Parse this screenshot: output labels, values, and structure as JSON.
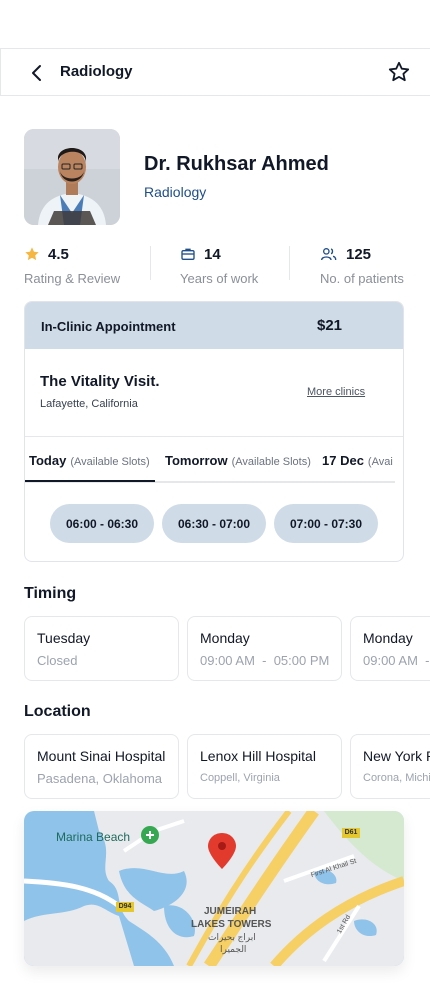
{
  "header": {
    "title": "Radiology",
    "back_icon": "chevron-left-icon",
    "favorite_icon": "star-outline-icon"
  },
  "doctor": {
    "name": "Dr. Rukhsar Ahmed",
    "specialty": "Radiology"
  },
  "stats": [
    {
      "value": "4.5",
      "label": "Rating & Review",
      "icon": "star-icon",
      "color": "#f5b642"
    },
    {
      "value": "14",
      "label": "Years of work",
      "icon": "briefcase-icon",
      "color": "#1f4e89"
    },
    {
      "value": "125",
      "label": "No. of patients",
      "icon": "users-icon",
      "color": "#1f4e89"
    }
  ],
  "appointment": {
    "title": "In-Clinic Appointment",
    "price": "$21",
    "clinic_name": "The Vitality Visit.",
    "clinic_address": "Lafayette, California",
    "more_link": "More clinics",
    "tabs": [
      {
        "day": "Today",
        "note": "(Available Slots)"
      },
      {
        "day": "Tomorrow",
        "note": "(Available Slots)"
      },
      {
        "day": "17 Dec",
        "note": "(Avai"
      }
    ],
    "slots": [
      "06:00 - 06:30",
      "06:30 - 07:00",
      "07:00 - 07:30"
    ]
  },
  "timing": {
    "title": "Timing",
    "cards": [
      {
        "day": "Tuesday",
        "hours": "Closed"
      },
      {
        "day": "Monday",
        "hours": "09:00 AM  -  05:00 PM"
      },
      {
        "day": "Monday",
        "hours": "09:00 AM  -"
      }
    ]
  },
  "location": {
    "title": "Location",
    "cards": [
      {
        "name": "Mount Sinai Hospital",
        "place": "Pasadena, Oklahoma"
      },
      {
        "name": "Lenox Hill Hospital",
        "place": "Coppell, Virginia"
      },
      {
        "name": "New York P",
        "place": "Corona, Michig"
      }
    ]
  },
  "map": {
    "labels": {
      "beach": "Marina Beach",
      "towers_line1": "JUMEIRAH",
      "towers_line2": "LAKES TOWERS",
      "arabic_line1": "ابراج بحيرات",
      "arabic_line2": "الجميرا",
      "street1": "First Al Khail St",
      "street2": "1st Rd",
      "road_d61": "D61",
      "road_d94": "D94"
    },
    "pin_icon": "map-pin-icon",
    "water_color": "#8fc3ea",
    "land_color": "#e8eaed",
    "road_color": "#f6cf65",
    "pin_color": "#e23b2e"
  },
  "colors": {
    "accent": "#1f4e89",
    "panel": "#cfdbe7",
    "star": "#f5b642"
  }
}
